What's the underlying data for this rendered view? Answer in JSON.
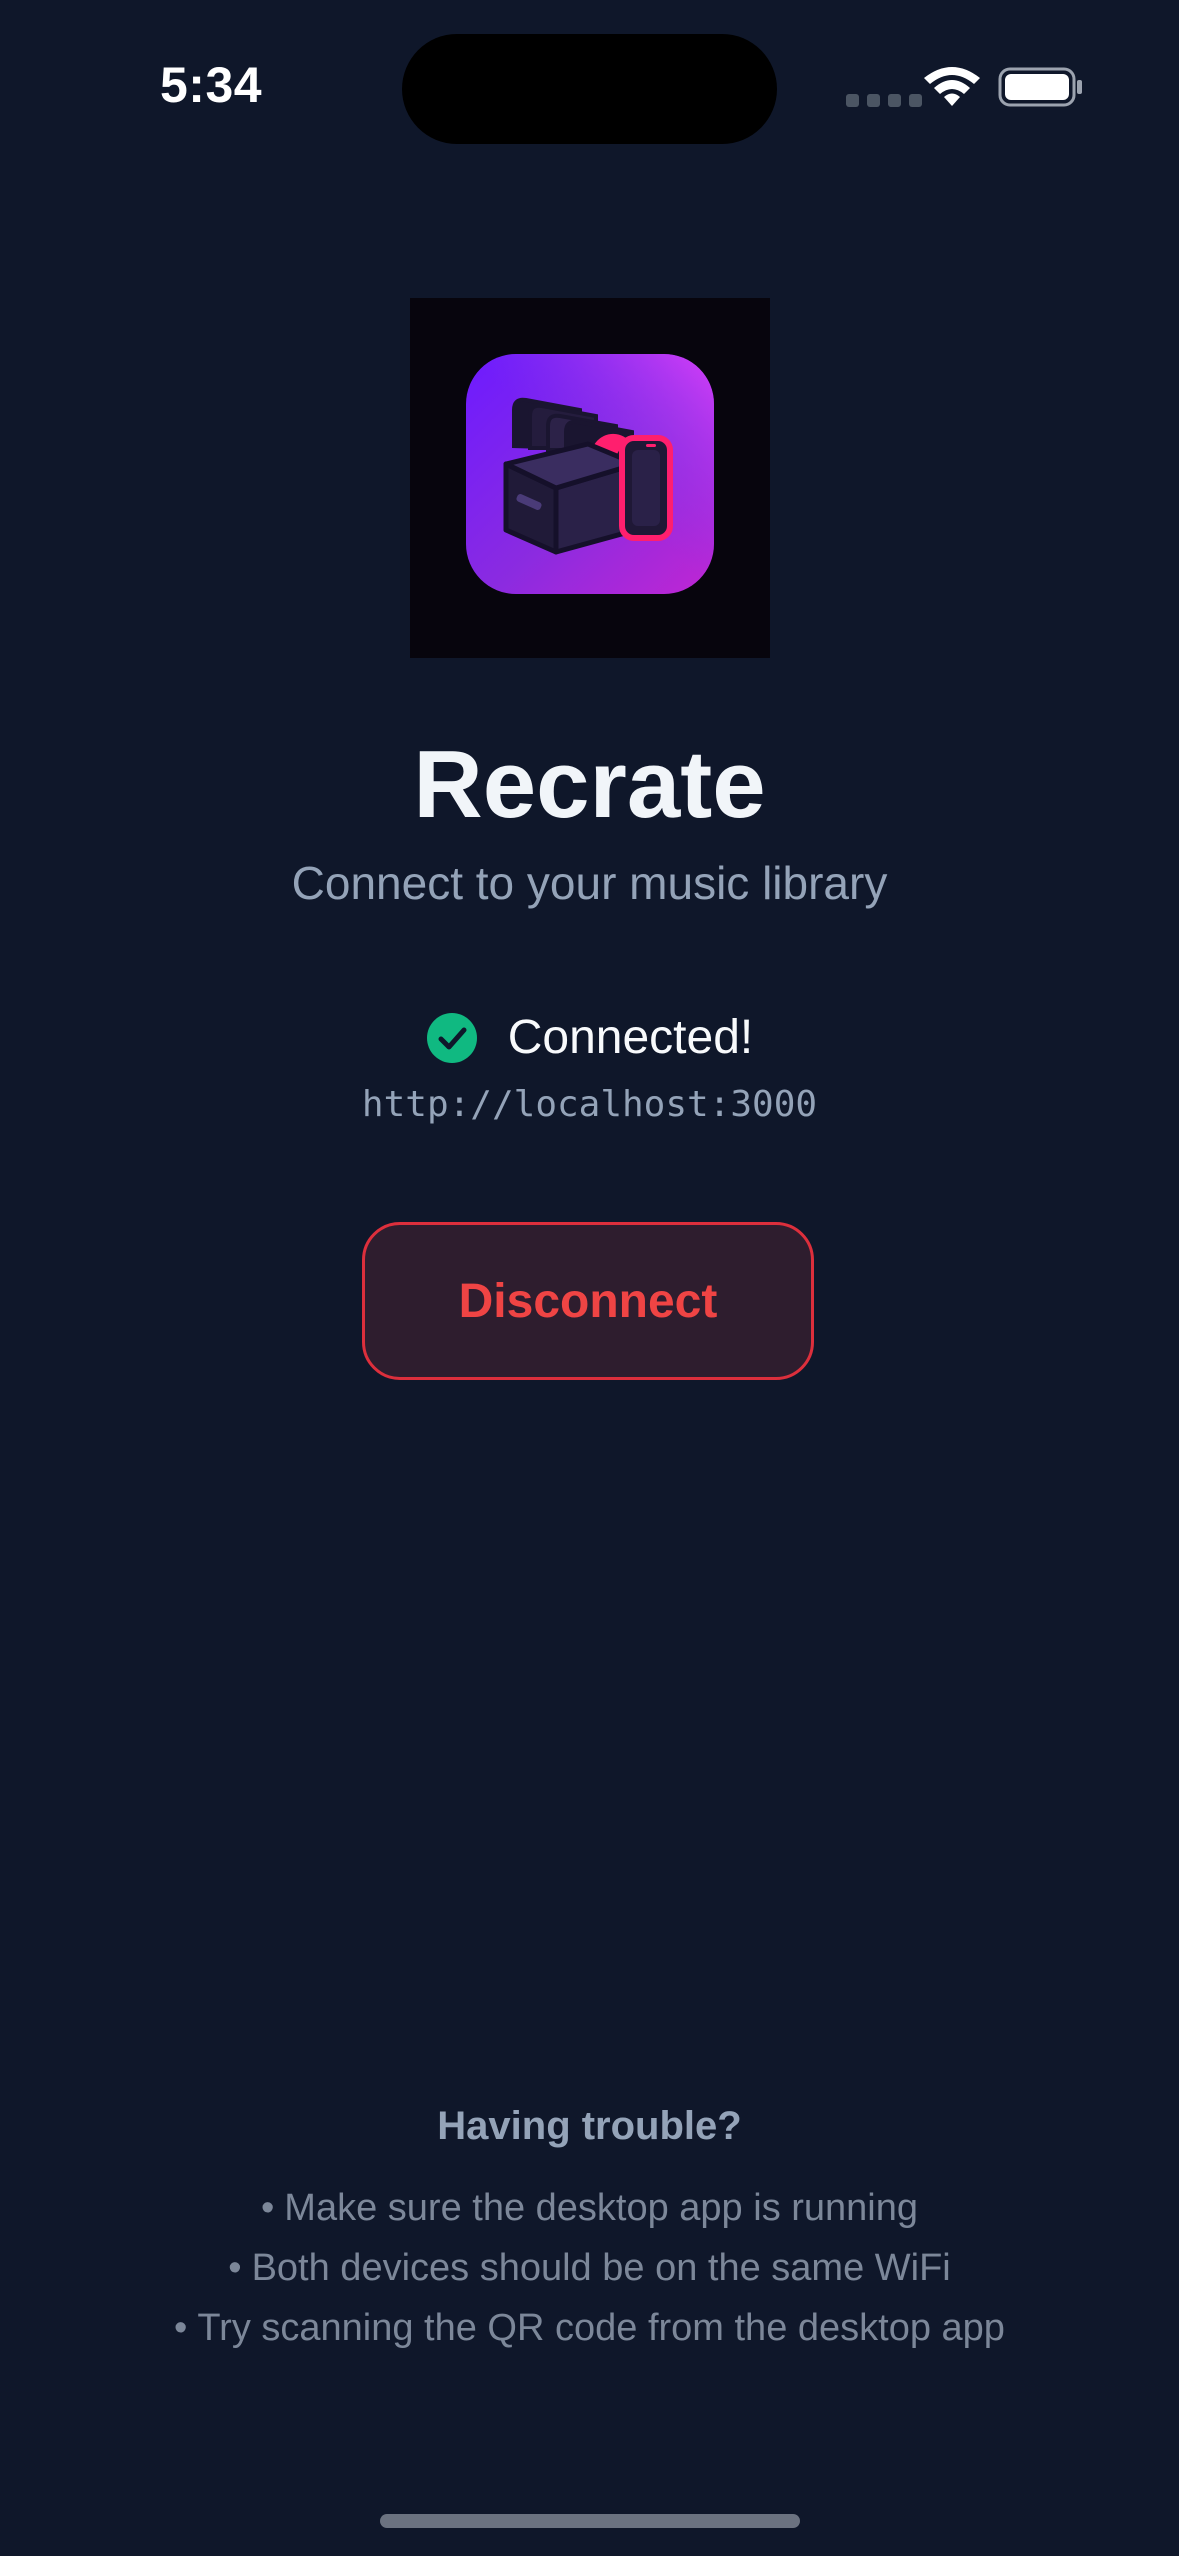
{
  "status_bar": {
    "time": "5:34",
    "icons": [
      "signal-icon",
      "wifi-icon",
      "battery-icon"
    ]
  },
  "app": {
    "logo": "recrate-logo-icon",
    "title": "Recrate",
    "subtitle": "Connect to your music library"
  },
  "connection": {
    "status_text": "Connected!",
    "status_icon": "check-circle-icon",
    "status_color": "#10b981",
    "server_url": "http://localhost:3000"
  },
  "actions": {
    "disconnect_label": "Disconnect",
    "disconnect_color": "#ef4444"
  },
  "help": {
    "title": "Having trouble?",
    "tips": [
      "Make sure the desktop app is running",
      "Both devices should be on the same WiFi",
      "Try scanning the QR code from the desktop app"
    ]
  },
  "colors": {
    "background": "#0f172a",
    "accent_purple": "#7c3aed",
    "accent_pink": "#ec4899"
  }
}
